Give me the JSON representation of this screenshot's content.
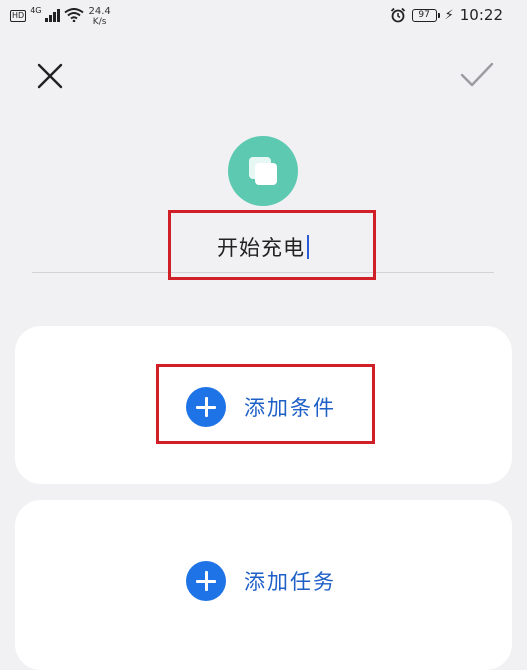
{
  "status_bar": {
    "sim_label": "HD",
    "network_type": "4G",
    "speed_value": "24.4",
    "speed_unit": "K/s",
    "battery_level": "97",
    "time": "10:22",
    "icons": [
      "signal-icon",
      "wifi-icon",
      "alarm-icon",
      "battery-icon",
      "charging-icon"
    ]
  },
  "header": {
    "close_icon": "close-icon",
    "confirm_icon": "check-icon"
  },
  "app_icon": {
    "name": "copy-icon",
    "color": "#5ec9b1"
  },
  "name_field": {
    "value": "开始充电"
  },
  "conditions": {
    "add_label": "添加条件",
    "icon": "plus-circle-icon"
  },
  "tasks": {
    "add_label": "添加任务",
    "icon": "plus-circle-icon"
  },
  "colors": {
    "accent": "#1e73e6",
    "highlight": "#d01f26",
    "background": "#f1f1f3"
  }
}
